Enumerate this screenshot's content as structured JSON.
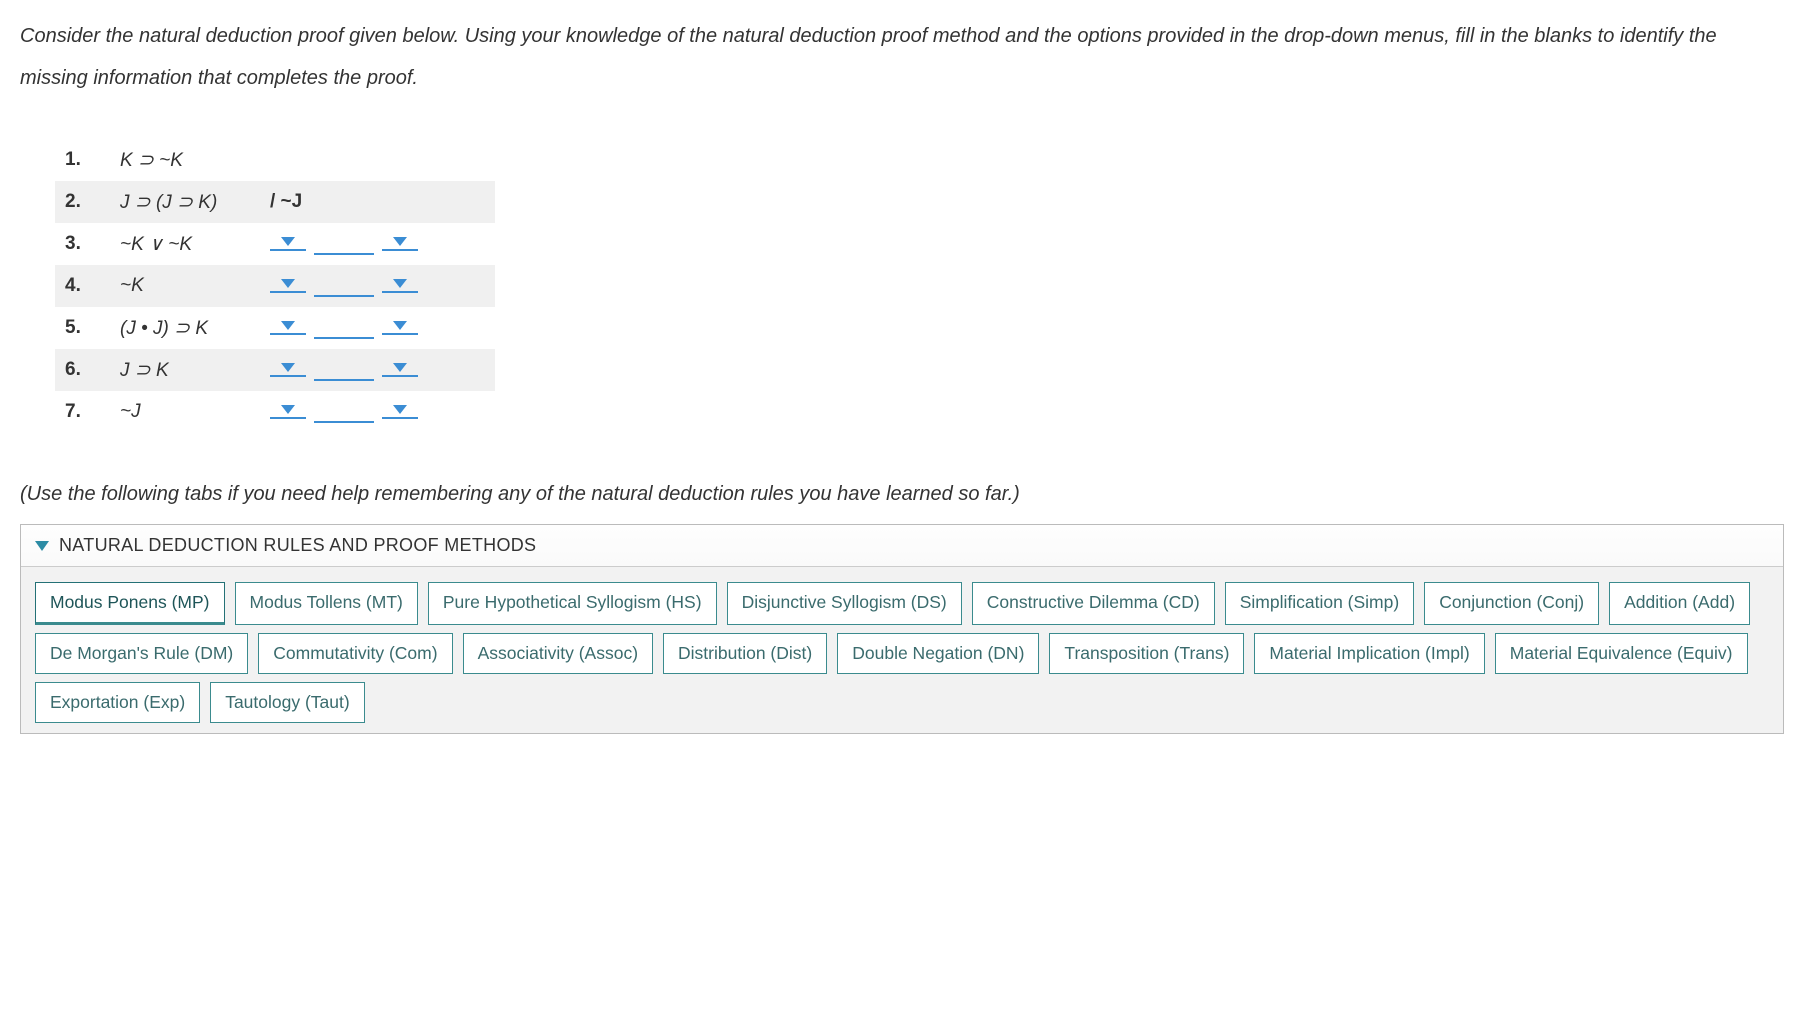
{
  "instructions": "Consider the natural deduction proof given below. Using your knowledge of the natural deduction proof method and the options provided in the drop-down menus, fill in the blanks to identify the missing information that completes the proof.",
  "proof": {
    "rows": [
      {
        "num": "1.",
        "stmt": "K ⊃ ~K",
        "shaded": false,
        "hasDropdowns": false
      },
      {
        "num": "2.",
        "stmt": "J ⊃ (J ⊃ K)",
        "conclusion": "/  ~J",
        "shaded": true,
        "hasDropdowns": false
      },
      {
        "num": "3.",
        "stmt": "~K ∨ ~K",
        "shaded": false,
        "hasDropdowns": true
      },
      {
        "num": "4.",
        "stmt": "~K",
        "shaded": true,
        "hasDropdowns": true
      },
      {
        "num": "5.",
        "stmt": "(J • J) ⊃ K",
        "shaded": false,
        "hasDropdowns": true
      },
      {
        "num": "6.",
        "stmt": "J ⊃ K",
        "shaded": true,
        "hasDropdowns": true
      },
      {
        "num": "7.",
        "stmt": "~J",
        "shaded": false,
        "hasDropdowns": true
      }
    ]
  },
  "helpText": "(Use the following tabs if you need help remembering any of the natural deduction rules you have learned so far.)",
  "rulesPanel": {
    "title": "NATURAL DEDUCTION RULES AND PROOF METHODS",
    "tabs": [
      {
        "label": "Modus Ponens (MP)",
        "active": true
      },
      {
        "label": "Modus Tollens (MT)",
        "active": false
      },
      {
        "label": "Pure Hypothetical Syllogism (HS)",
        "active": false
      },
      {
        "label": "Disjunctive Syllogism (DS)",
        "active": false
      },
      {
        "label": "Constructive Dilemma (CD)",
        "active": false
      },
      {
        "label": "Simplification (Simp)",
        "active": false
      },
      {
        "label": "Conjunction (Conj)",
        "active": false
      },
      {
        "label": "Addition (Add)",
        "active": false
      },
      {
        "label": "De Morgan's Rule (DM)",
        "active": false
      },
      {
        "label": "Commutativity (Com)",
        "active": false
      },
      {
        "label": "Associativity (Assoc)",
        "active": false
      },
      {
        "label": "Distribution (Dist)",
        "active": false
      },
      {
        "label": "Double Negation (DN)",
        "active": false
      },
      {
        "label": "Transposition (Trans)",
        "active": false
      },
      {
        "label": "Material Implication (Impl)",
        "active": false
      },
      {
        "label": "Material Equivalence (Equiv)",
        "active": false
      },
      {
        "label": "Exportation (Exp)",
        "active": false
      },
      {
        "label": "Tautology (Taut)",
        "active": false
      }
    ]
  }
}
